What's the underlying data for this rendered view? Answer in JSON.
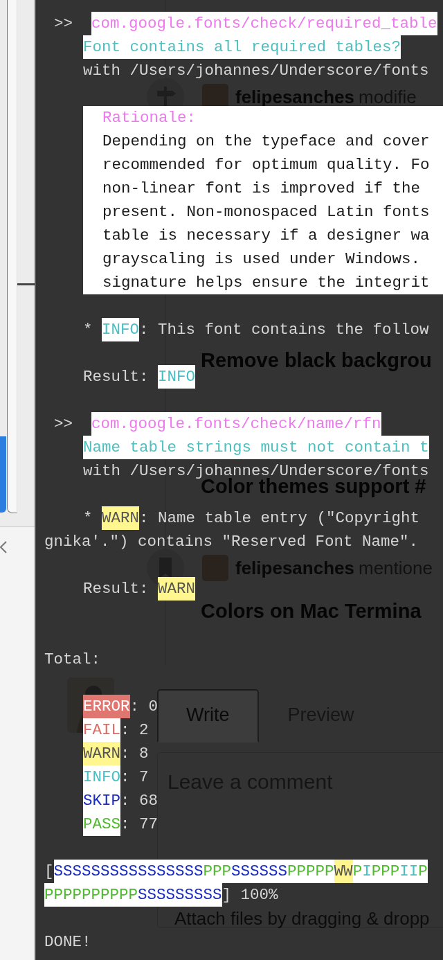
{
  "background_page": {
    "timeline": [
      {
        "kind": "milestoned",
        "user": "felipesanches",
        "action": "modifie"
      },
      {
        "kind": "title",
        "text": "Remove black backgrou"
      },
      {
        "kind": "title",
        "text": "Color themes support #"
      },
      {
        "kind": "mentioned",
        "user": "felipesanches",
        "action": "mentione"
      },
      {
        "kind": "title",
        "text": "Colors on Mac Termina"
      }
    ],
    "comment_box": {
      "tabs": [
        {
          "label": "Write",
          "selected": true
        },
        {
          "label": "Preview",
          "selected": false
        }
      ],
      "placeholder": "Leave a comment",
      "attach_hint": "Attach files by dragging & dropp"
    }
  },
  "terminal": {
    "checks": [
      {
        "prompt": ">>",
        "check_id": "com.google.fonts/check/required_table",
        "description": "Font contains all required tables?",
        "target": "with /Users/johannes/Underscore/fonts",
        "rationale": {
          "label": "Rationale:",
          "lines": [
            "Depending on the typeface and cover",
            "recommended for optimum quality. Fo",
            "non-linear font is improved if the",
            "present. Non-monospaced Latin fonts",
            "table is necessary if a designer wa",
            "grayscaling is used under Windows.",
            "signature helps ensure the integrit"
          ]
        },
        "messages": [
          {
            "bullet": "*",
            "status": "INFO",
            "kind": "info",
            "text": ": This font contains the follow"
          }
        ],
        "result": {
          "label": "Result:",
          "status": "INFO",
          "kind": "info"
        }
      },
      {
        "prompt": ">>",
        "check_id": "com.google.fonts/check/name/rfn",
        "description": "Name table strings must not contain t",
        "target": "with /Users/johannes/Underscore/fonts",
        "messages": [
          {
            "bullet": "*",
            "status": "WARN",
            "kind": "warn",
            "text": ": Name table entry (\"Copyright",
            "continuation": "gnika'.\") contains \"Reserved Font Name\"."
          }
        ],
        "result": {
          "label": "Result:",
          "status": "WARN",
          "kind": "warn"
        }
      }
    ],
    "total": {
      "label": "Total:",
      "items": [
        {
          "status": "ERROR",
          "kind": "error",
          "count": ": 0"
        },
        {
          "status": "FAIL",
          "kind": "fail",
          "count": ": 2"
        },
        {
          "status": "WARN",
          "kind": "warn",
          "count": ": 8"
        },
        {
          "status": "INFO",
          "kind": "info",
          "count": ": 7"
        },
        {
          "status": "SKIP",
          "kind": "skip",
          "count": ": 68"
        },
        {
          "status": "PASS",
          "kind": "pass",
          "count": ": 77"
        }
      ]
    },
    "progress": {
      "open": "[",
      "rows": [
        [
          {
            "kind": "skip",
            "text": "SSSSSSSSSSSSSSSS"
          },
          {
            "kind": "pass",
            "text": "PPP"
          },
          {
            "kind": "skip",
            "text": "SSSSSS"
          },
          {
            "kind": "pass",
            "text": "PPPPP"
          },
          {
            "kind": "warn",
            "text": "WW"
          },
          {
            "kind": "pass",
            "text": "P"
          },
          {
            "kind": "info",
            "text": "I"
          },
          {
            "kind": "pass",
            "text": "PPP"
          },
          {
            "kind": "info",
            "text": "II"
          },
          {
            "kind": "pass",
            "text": "P"
          }
        ],
        [
          {
            "kind": "pass",
            "text": "PPPPPPPPPP"
          },
          {
            "kind": "skip",
            "text": "SSSSSSSSS"
          }
        ]
      ],
      "close": "] 100%"
    },
    "done": "DONE!"
  }
}
